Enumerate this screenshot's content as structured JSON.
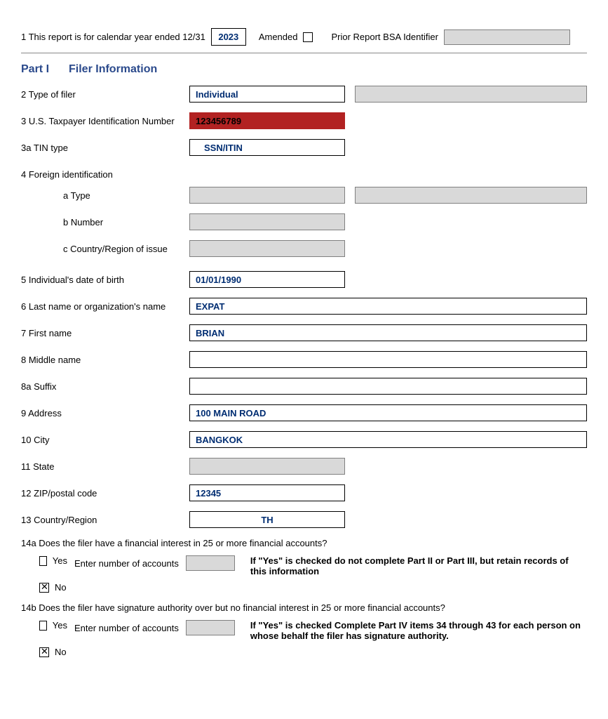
{
  "header": {
    "line1_prefix": "1  This report is for calendar year ended 12/31",
    "year": "2023",
    "amended_label": "Amended",
    "amended_checked": false,
    "bsa_label": "Prior Report BSA Identifier",
    "bsa_value": ""
  },
  "part1": {
    "part_label": "Part I",
    "title": "Filer Information"
  },
  "rows": {
    "type_of_filer": {
      "label": "2 Type of filer",
      "value": "Individual",
      "aux": ""
    },
    "tin": {
      "label": "3 U.S. Taxpayer Identification Number",
      "value": "123456789"
    },
    "tin_type": {
      "label": "3a TIN type",
      "value": "SSN/ITIN"
    },
    "foreign_id": {
      "label": "4 Foreign identification"
    },
    "fi_a": {
      "label": "a Type",
      "value": "",
      "aux": ""
    },
    "fi_b": {
      "label": "b Number",
      "value": ""
    },
    "fi_c": {
      "label": "c Country/Region of issue",
      "value": ""
    },
    "dob": {
      "label": "5 Individual's date of birth",
      "value": "01/01/1990"
    },
    "last_name": {
      "label": "6 Last name  or organization's name",
      "value": "EXPAT"
    },
    "first_name": {
      "label": "7  First name",
      "value": "BRIAN"
    },
    "middle_name": {
      "label": "8  Middle name",
      "value": ""
    },
    "suffix": {
      "label": "8a Suffix",
      "value": ""
    },
    "address": {
      "label": " 9  Address",
      "value": "100 MAIN ROAD"
    },
    "city": {
      "label": "10  City",
      "value": "BANGKOK"
    },
    "state": {
      "label": "11 State",
      "value": ""
    },
    "zip": {
      "label": "12  ZIP/postal code",
      "value": "12345"
    },
    "country": {
      "label": "13 Country/Region",
      "value": "TH"
    }
  },
  "q14a": {
    "question": "14a  Does the filer have a financial interest in 25 or more financial accounts?",
    "yes_label": "Yes",
    "no_label": "No",
    "enter_label": "Enter  number of accounts",
    "count": "",
    "yes_checked": false,
    "no_checked": true,
    "hint": "If \"Yes\" is checked  do not complete Part II or Part III, but retain records of this information"
  },
  "q14b": {
    "question": "14b  Does the filer have signature authority over but no financial interest in 25 or more financial accounts?",
    "yes_label": "Yes",
    "no_label": "No",
    "enter_label": "Enter  number of accounts",
    "count": "",
    "yes_checked": false,
    "no_checked": true,
    "hint": "If \"Yes\" is checked Complete Part IV items 34 through 43 for each person on whose behalf the filer has signature authority."
  }
}
